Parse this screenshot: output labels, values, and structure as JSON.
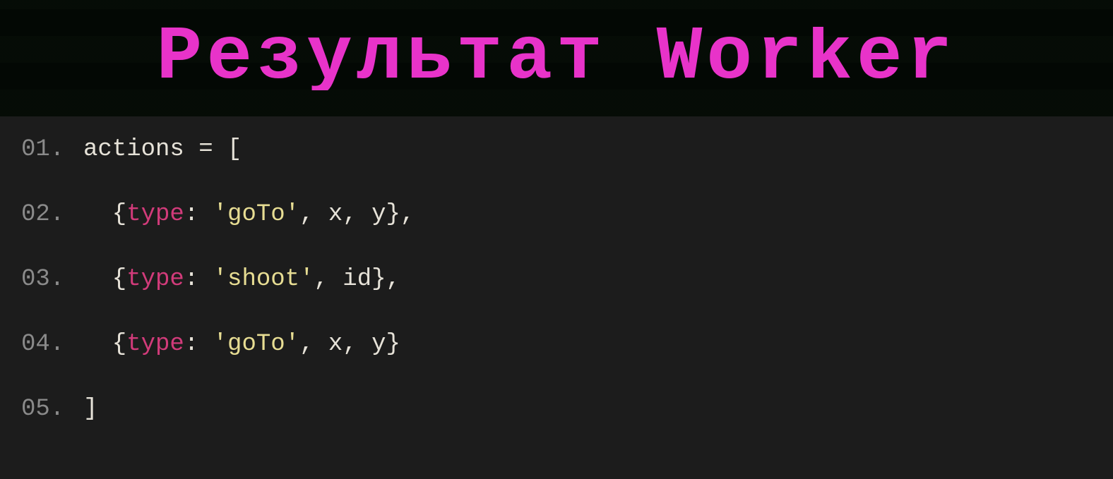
{
  "title": "Результат Worker",
  "colors": {
    "title": "#e833c9",
    "lineno": "#8a8a8a",
    "default": "#e6e2d8",
    "key": "#d13b7a",
    "string": "#e7dd93",
    "bg_header": "#0a0d0a",
    "bg_code": "#1c1c1c"
  },
  "code": {
    "lines": [
      {
        "num": "01.",
        "tokens": [
          {
            "t": "actions = [",
            "c": "default"
          }
        ]
      },
      {
        "num": "02.",
        "tokens": [
          {
            "t": "  {",
            "c": "default"
          },
          {
            "t": "type",
            "c": "key"
          },
          {
            "t": ": ",
            "c": "default"
          },
          {
            "t": "'goTo'",
            "c": "string"
          },
          {
            "t": ", x, y},",
            "c": "default"
          }
        ]
      },
      {
        "num": "03.",
        "tokens": [
          {
            "t": "  {",
            "c": "default"
          },
          {
            "t": "type",
            "c": "key"
          },
          {
            "t": ": ",
            "c": "default"
          },
          {
            "t": "'shoot'",
            "c": "string"
          },
          {
            "t": ", id},",
            "c": "default"
          }
        ]
      },
      {
        "num": "04.",
        "tokens": [
          {
            "t": "  {",
            "c": "default"
          },
          {
            "t": "type",
            "c": "key"
          },
          {
            "t": ": ",
            "c": "default"
          },
          {
            "t": "'goTo'",
            "c": "string"
          },
          {
            "t": ", x, y}",
            "c": "default"
          }
        ]
      },
      {
        "num": "05.",
        "tokens": [
          {
            "t": "]",
            "c": "default"
          }
        ]
      }
    ]
  }
}
